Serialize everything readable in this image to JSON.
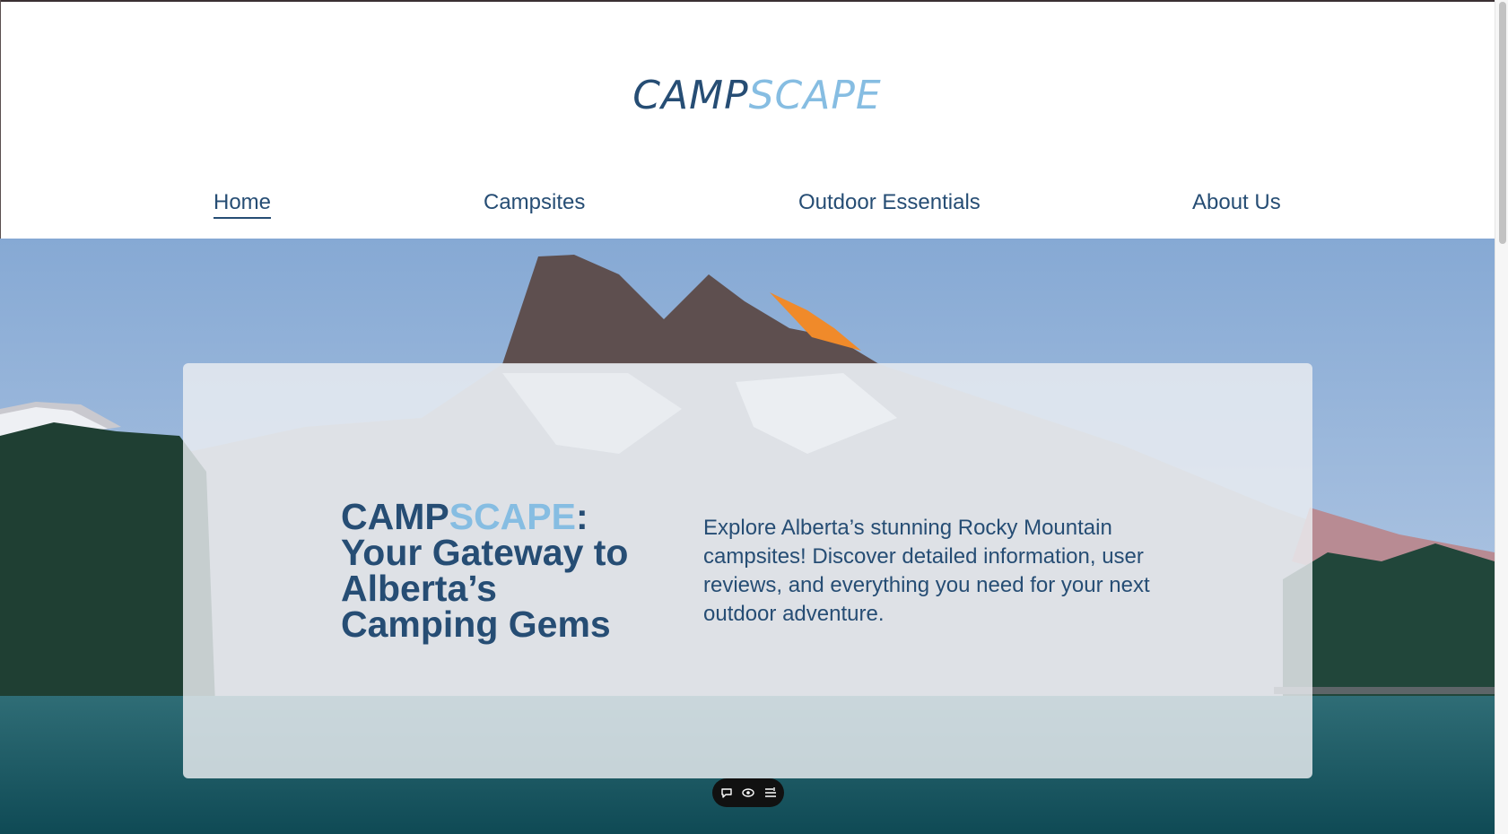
{
  "brand": {
    "logo_part1": "CAMP",
    "logo_part2": "SCAPE",
    "primary_color": "#264d74",
    "accent_color": "#86bde2"
  },
  "nav": {
    "items": [
      {
        "label": "Home",
        "active": true
      },
      {
        "label": "Campsites",
        "active": false
      },
      {
        "label": "Outdoor Essentials",
        "active": false
      },
      {
        "label": "About Us",
        "active": false
      }
    ]
  },
  "hero": {
    "title_part1": "CAMP",
    "title_part2": "SCAPE",
    "title_colon": ":",
    "title_rest": "Your Gateway to Alberta’s Camping Gems",
    "description": "Explore Alberta’s stunning Rocky Mountain campsites! Discover detailed information, user reviews, and everything you need for your next outdoor adventure."
  },
  "toolbar": {
    "icons": [
      "comment-icon",
      "eye-icon",
      "list-settings-icon"
    ]
  }
}
